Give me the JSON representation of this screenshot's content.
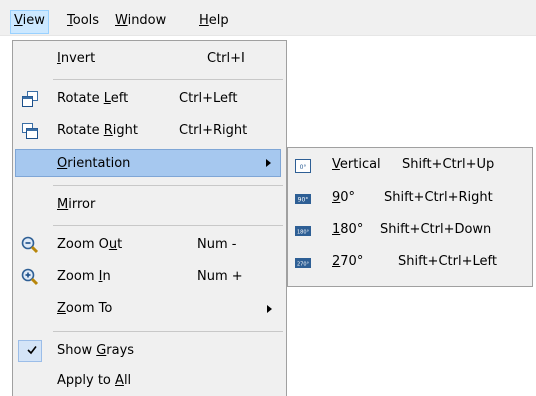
{
  "menubar": {
    "view": {
      "pre": "",
      "mn": "V",
      "post": "iew"
    },
    "tools": {
      "pre": "",
      "mn": "T",
      "post": "ools"
    },
    "window": {
      "pre": "",
      "mn": "W",
      "post": "indow"
    },
    "help": {
      "pre": "",
      "mn": "H",
      "post": "elp"
    }
  },
  "view_menu": {
    "invert": {
      "pre": "",
      "mn": "I",
      "post": "nvert",
      "shortcut": "Ctrl+I"
    },
    "rotate_left": {
      "pre": "Rotate ",
      "mn": "L",
      "post": "eft",
      "shortcut": "Ctrl+Left"
    },
    "rotate_right": {
      "pre": "Rotate ",
      "mn": "R",
      "post": "ight",
      "shortcut": "Ctrl+Right"
    },
    "orientation": {
      "pre": "",
      "mn": "O",
      "post": "rientation"
    },
    "mirror": {
      "pre": "",
      "mn": "M",
      "post": "irror"
    },
    "zoom_out": {
      "pre": "Zoom O",
      "mn": "u",
      "post": "t",
      "shortcut": "Num -"
    },
    "zoom_in": {
      "pre": "Zoom ",
      "mn": "I",
      "post": "n",
      "shortcut": "Num +"
    },
    "zoom_to": {
      "pre": "",
      "mn": "Z",
      "post": "oom To"
    },
    "show_grays": {
      "pre": "Show ",
      "mn": "G",
      "post": "rays",
      "checked": true
    },
    "apply_to_all": {
      "pre": "Apply to ",
      "mn": "A",
      "post": "ll"
    }
  },
  "orientation_menu": {
    "vertical": {
      "pre": "",
      "mn": "V",
      "post": "ertical",
      "shortcut": "Shift+Ctrl+Up"
    },
    "deg90": {
      "pre": "",
      "mn": "9",
      "post": "0°",
      "shortcut": "Shift+Ctrl+Right"
    },
    "deg180": {
      "pre": "",
      "mn": "1",
      "post": "80°",
      "shortcut": "Shift+Ctrl+Down"
    },
    "deg270": {
      "pre": "",
      "mn": "2",
      "post": "70°",
      "shortcut": "Shift+Ctrl+Left"
    }
  },
  "colors": {
    "highlight": "#a6c8ef",
    "menubar_active": "#cce8ff",
    "menu_bg": "#f0f0f0"
  }
}
